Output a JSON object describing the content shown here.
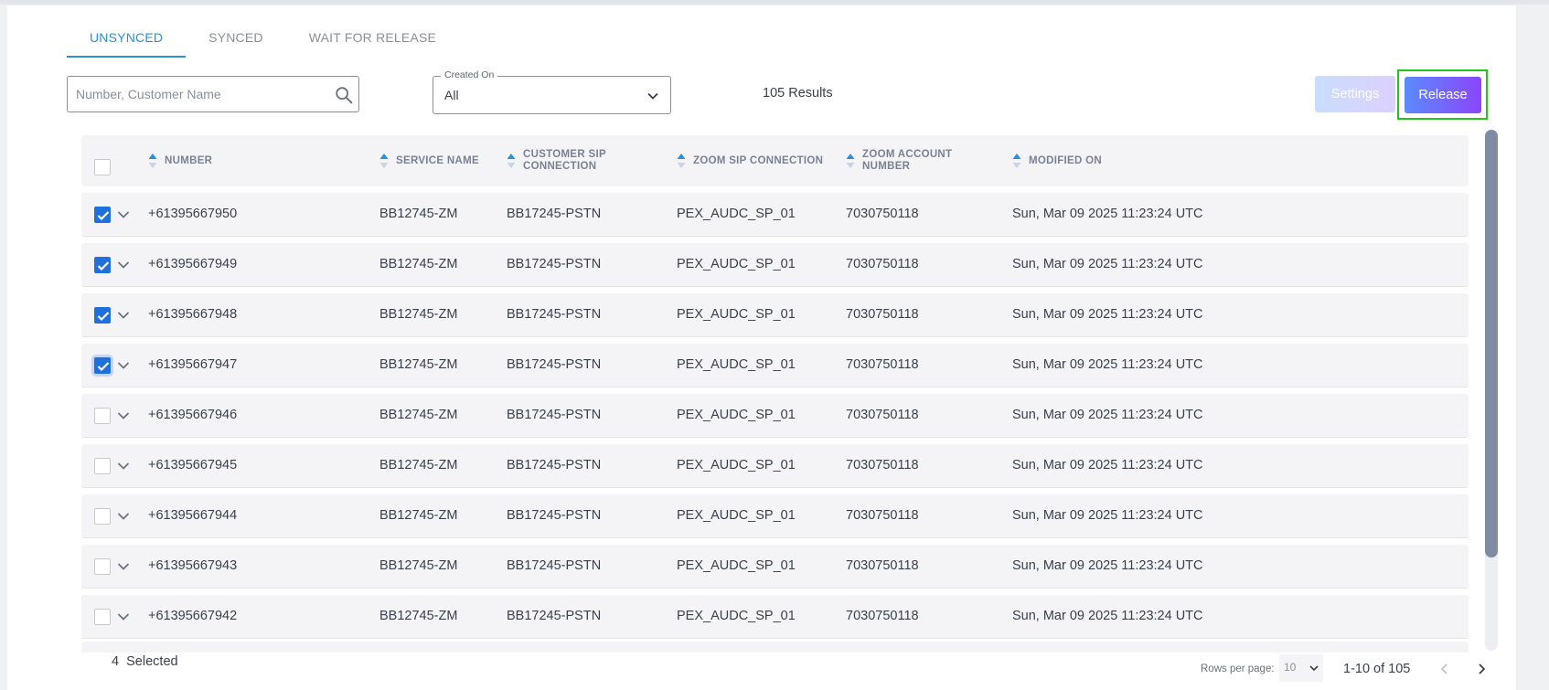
{
  "tabs": [
    {
      "label": "UNSYNCED",
      "active": true
    },
    {
      "label": "SYNCED",
      "active": false
    },
    {
      "label": "WAIT FOR RELEASE",
      "active": false
    }
  ],
  "search": {
    "placeholder": "Number, Customer Name",
    "value": ""
  },
  "created_on": {
    "label": "Created On",
    "value": "All"
  },
  "results_text": "105 Results",
  "buttons": {
    "settings": "Settings",
    "release": "Release"
  },
  "table": {
    "columns": [
      "NUMBER",
      "SERVICE NAME",
      "CUSTOMER SIP CONNECTION",
      "ZOOM SIP CONNECTION",
      "ZOOM ACCOUNT NUMBER",
      "MODIFIED ON"
    ],
    "column_lines": [
      [
        "NUMBER"
      ],
      [
        "SERVICE NAME"
      ],
      [
        "CUSTOMER SIP",
        "CONNECTION"
      ],
      [
        "ZOOM SIP CONNECTION"
      ],
      [
        "ZOOM ACCOUNT",
        "NUMBER"
      ],
      [
        "MODIFIED ON"
      ]
    ],
    "rows": [
      {
        "checked": true,
        "number": "+61395667950",
        "service_name": "BB12745-ZM",
        "customer_sip": "BB17245-PSTN",
        "zoom_sip": "PEX_AUDC_SP_01",
        "zoom_account": "7030750118",
        "modified_on": "Sun, Mar 09 2025 11:23:24 UTC"
      },
      {
        "checked": true,
        "number": "+61395667949",
        "service_name": "BB12745-ZM",
        "customer_sip": "BB17245-PSTN",
        "zoom_sip": "PEX_AUDC_SP_01",
        "zoom_account": "7030750118",
        "modified_on": "Sun, Mar 09 2025 11:23:24 UTC"
      },
      {
        "checked": true,
        "number": "+61395667948",
        "service_name": "BB12745-ZM",
        "customer_sip": "BB17245-PSTN",
        "zoom_sip": "PEX_AUDC_SP_01",
        "zoom_account": "7030750118",
        "modified_on": "Sun, Mar 09 2025 11:23:24 UTC"
      },
      {
        "checked": true,
        "focus": true,
        "number": "+61395667947",
        "service_name": "BB12745-ZM",
        "customer_sip": "BB17245-PSTN",
        "zoom_sip": "PEX_AUDC_SP_01",
        "zoom_account": "7030750118",
        "modified_on": "Sun, Mar 09 2025 11:23:24 UTC"
      },
      {
        "checked": false,
        "number": "+61395667946",
        "service_name": "BB12745-ZM",
        "customer_sip": "BB17245-PSTN",
        "zoom_sip": "PEX_AUDC_SP_01",
        "zoom_account": "7030750118",
        "modified_on": "Sun, Mar 09 2025 11:23:24 UTC"
      },
      {
        "checked": false,
        "number": "+61395667945",
        "service_name": "BB12745-ZM",
        "customer_sip": "BB17245-PSTN",
        "zoom_sip": "PEX_AUDC_SP_01",
        "zoom_account": "7030750118",
        "modified_on": "Sun, Mar 09 2025 11:23:24 UTC"
      },
      {
        "checked": false,
        "number": "+61395667944",
        "service_name": "BB12745-ZM",
        "customer_sip": "BB17245-PSTN",
        "zoom_sip": "PEX_AUDC_SP_01",
        "zoom_account": "7030750118",
        "modified_on": "Sun, Mar 09 2025 11:23:24 UTC"
      },
      {
        "checked": false,
        "number": "+61395667943",
        "service_name": "BB12745-ZM",
        "customer_sip": "BB17245-PSTN",
        "zoom_sip": "PEX_AUDC_SP_01",
        "zoom_account": "7030750118",
        "modified_on": "Sun, Mar 09 2025 11:23:24 UTC"
      },
      {
        "checked": false,
        "number": "+61395667942",
        "service_name": "BB12745-ZM",
        "customer_sip": "BB17245-PSTN",
        "zoom_sip": "PEX_AUDC_SP_01",
        "zoom_account": "7030750118",
        "modified_on": "Sun, Mar 09 2025 11:23:24 UTC"
      }
    ]
  },
  "footer": {
    "selected_count": "4",
    "selected_label": "Selected",
    "rows_per_page_label": "Rows per page:",
    "rows_per_page_value": "10",
    "range_text": "1-10 of 105"
  },
  "colors": {
    "accent": "#2b8fd9",
    "checkbox": "#1f6fdc",
    "release_start": "#5b8bfb",
    "release_end": "#8b46fb",
    "highlight": "#22c51c"
  },
  "icons": {
    "search": "search-icon",
    "dropdown": "chevron-down-icon",
    "expand": "chevron-down-icon",
    "sort": "sort-icon",
    "prev": "chevron-left-icon",
    "next": "chevron-right-icon"
  }
}
